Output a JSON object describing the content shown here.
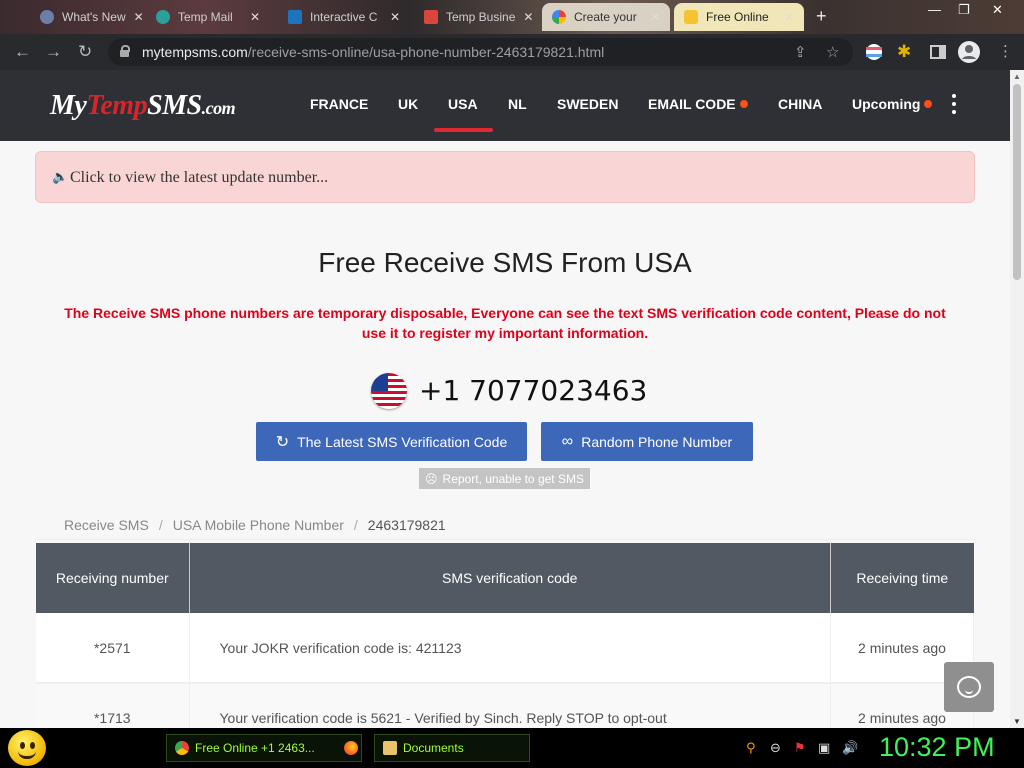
{
  "browser": {
    "tabs": [
      {
        "title": "What's New",
        "close": "✕"
      },
      {
        "title": "Temp Mail",
        "close": "✕"
      },
      {
        "title": "Interactive C",
        "close": "✕"
      },
      {
        "title": "Temp Busine",
        "close": "✕"
      },
      {
        "title": "Create your",
        "close": "✕"
      },
      {
        "title": "Free Online",
        "close": "✕"
      }
    ],
    "new_tab": "+",
    "url_domain": "mytempsms.com",
    "url_path": "/receive-sms-online/usa-phone-number-2463179821.html"
  },
  "site": {
    "logo": {
      "part1": "My",
      "part2": "Temp",
      "part3": "SMS",
      "part4": ".com"
    },
    "nav": [
      "FRANCE",
      "UK",
      "USA",
      "NL",
      "SWEDEN",
      "EMAIL CODE",
      "CHINA",
      "Upcoming"
    ],
    "active_nav": "USA",
    "notice": "Click to view the latest update number...",
    "title": "Free Receive SMS From USA",
    "warning": "The Receive SMS phone numbers are temporary disposable, Everyone can see the text SMS verification code content, Please do not use it to register my important information.",
    "phone_number": "+1 7077023463",
    "buttons": {
      "latest": "The Latest SMS Verification Code",
      "random": "Random Phone Number",
      "report": "Report, unable to get SMS"
    },
    "breadcrumb": [
      "Receive SMS",
      "USA Mobile Phone Number",
      "2463179821"
    ],
    "breadcrumb_sep": "/",
    "table": {
      "headers": [
        "Receiving number",
        "SMS verification code",
        "Receiving time"
      ],
      "rows": [
        {
          "number": "*2571",
          "message": "Your JOKR verification code is: 421123",
          "time": "2 minutes ago"
        },
        {
          "number": "*1713",
          "message": "Your verification code is 5621 - Verified by Sinch. Reply STOP to opt-out",
          "time": "2 minutes ago"
        }
      ]
    }
  },
  "taskbar": {
    "tasks": [
      "Free Online +1 2463...",
      "Documents"
    ],
    "clock": "10:32 PM"
  },
  "colors": {
    "accent_blue": "#3d67b9",
    "brand_red": "#d9252a",
    "nav_bg": "#2f3035",
    "warning_red": "#e0001a",
    "clock_green": "#3ff25a"
  }
}
